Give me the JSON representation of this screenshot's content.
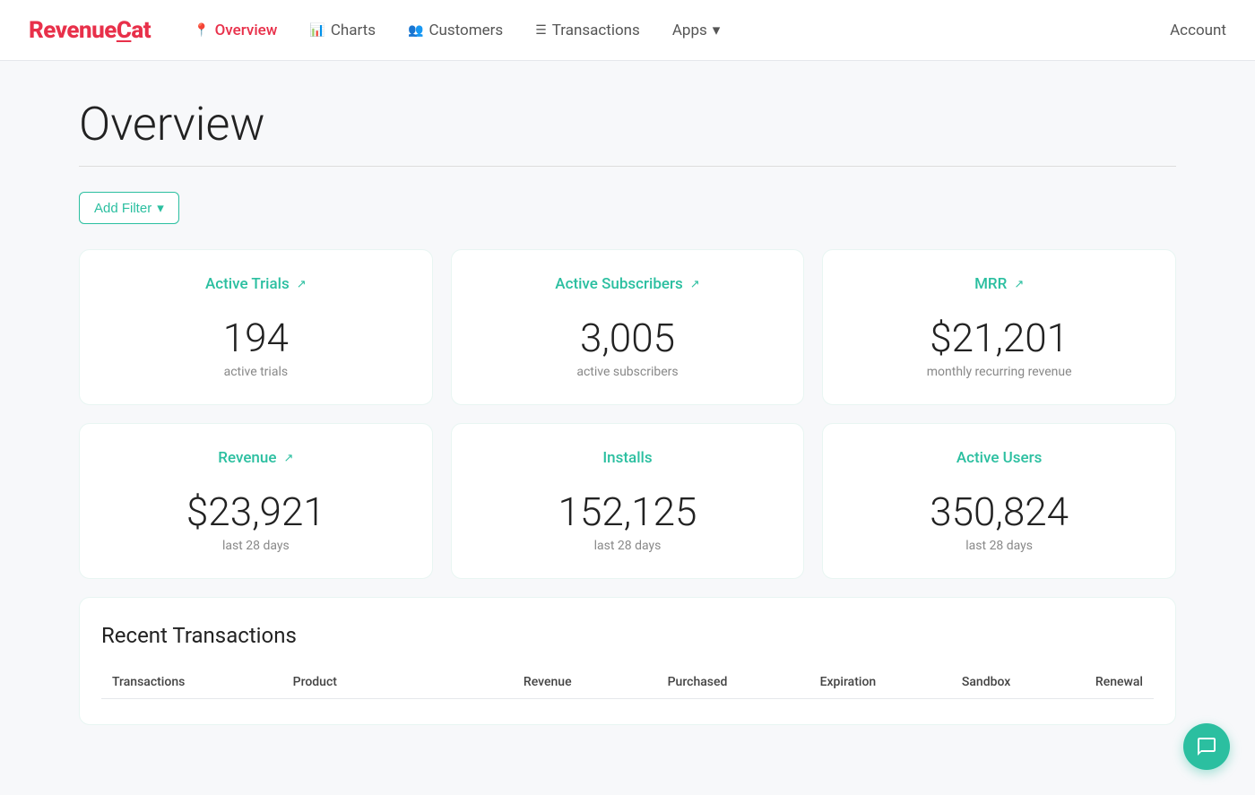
{
  "nav": {
    "logo": "RevenueCat",
    "logo_underline": "C",
    "links": [
      {
        "id": "overview",
        "label": "Overview",
        "icon": "📍",
        "active": true
      },
      {
        "id": "charts",
        "label": "Charts",
        "icon": "📊",
        "active": false
      },
      {
        "id": "customers",
        "label": "Customers",
        "icon": "👥",
        "active": false
      },
      {
        "id": "transactions",
        "label": "Transactions",
        "icon": "☰",
        "active": false
      },
      {
        "id": "apps",
        "label": "Apps",
        "icon": "",
        "active": false,
        "dropdown": true
      }
    ],
    "account_label": "Account"
  },
  "page": {
    "title": "Overview"
  },
  "filter_btn": {
    "label": "Add Filter",
    "dropdown_icon": "▾"
  },
  "stat_cards_row1": [
    {
      "id": "active-trials",
      "title": "Active Trials",
      "ext_icon": "↗",
      "value": "194",
      "label": "active trials"
    },
    {
      "id": "active-subscribers",
      "title": "Active Subscribers",
      "ext_icon": "↗",
      "value": "3,005",
      "label": "active subscribers"
    },
    {
      "id": "mrr",
      "title": "MRR",
      "ext_icon": "↗",
      "value": "$21,201",
      "label": "monthly recurring revenue"
    }
  ],
  "stat_cards_row2": [
    {
      "id": "revenue",
      "title": "Revenue",
      "ext_icon": "↗",
      "value": "$23,921",
      "label": "last 28 days"
    },
    {
      "id": "installs",
      "title": "Installs",
      "ext_icon": "",
      "value": "152,125",
      "label": "last 28 days"
    },
    {
      "id": "active-users",
      "title": "Active Users",
      "ext_icon": "",
      "value": "350,824",
      "label": "last 28 days"
    }
  ],
  "recent_transactions": {
    "title": "Recent Transactions",
    "columns": [
      "Transactions",
      "Product",
      "",
      "Revenue",
      "Purchased",
      "Expiration",
      "Sandbox",
      "Renewal"
    ]
  }
}
